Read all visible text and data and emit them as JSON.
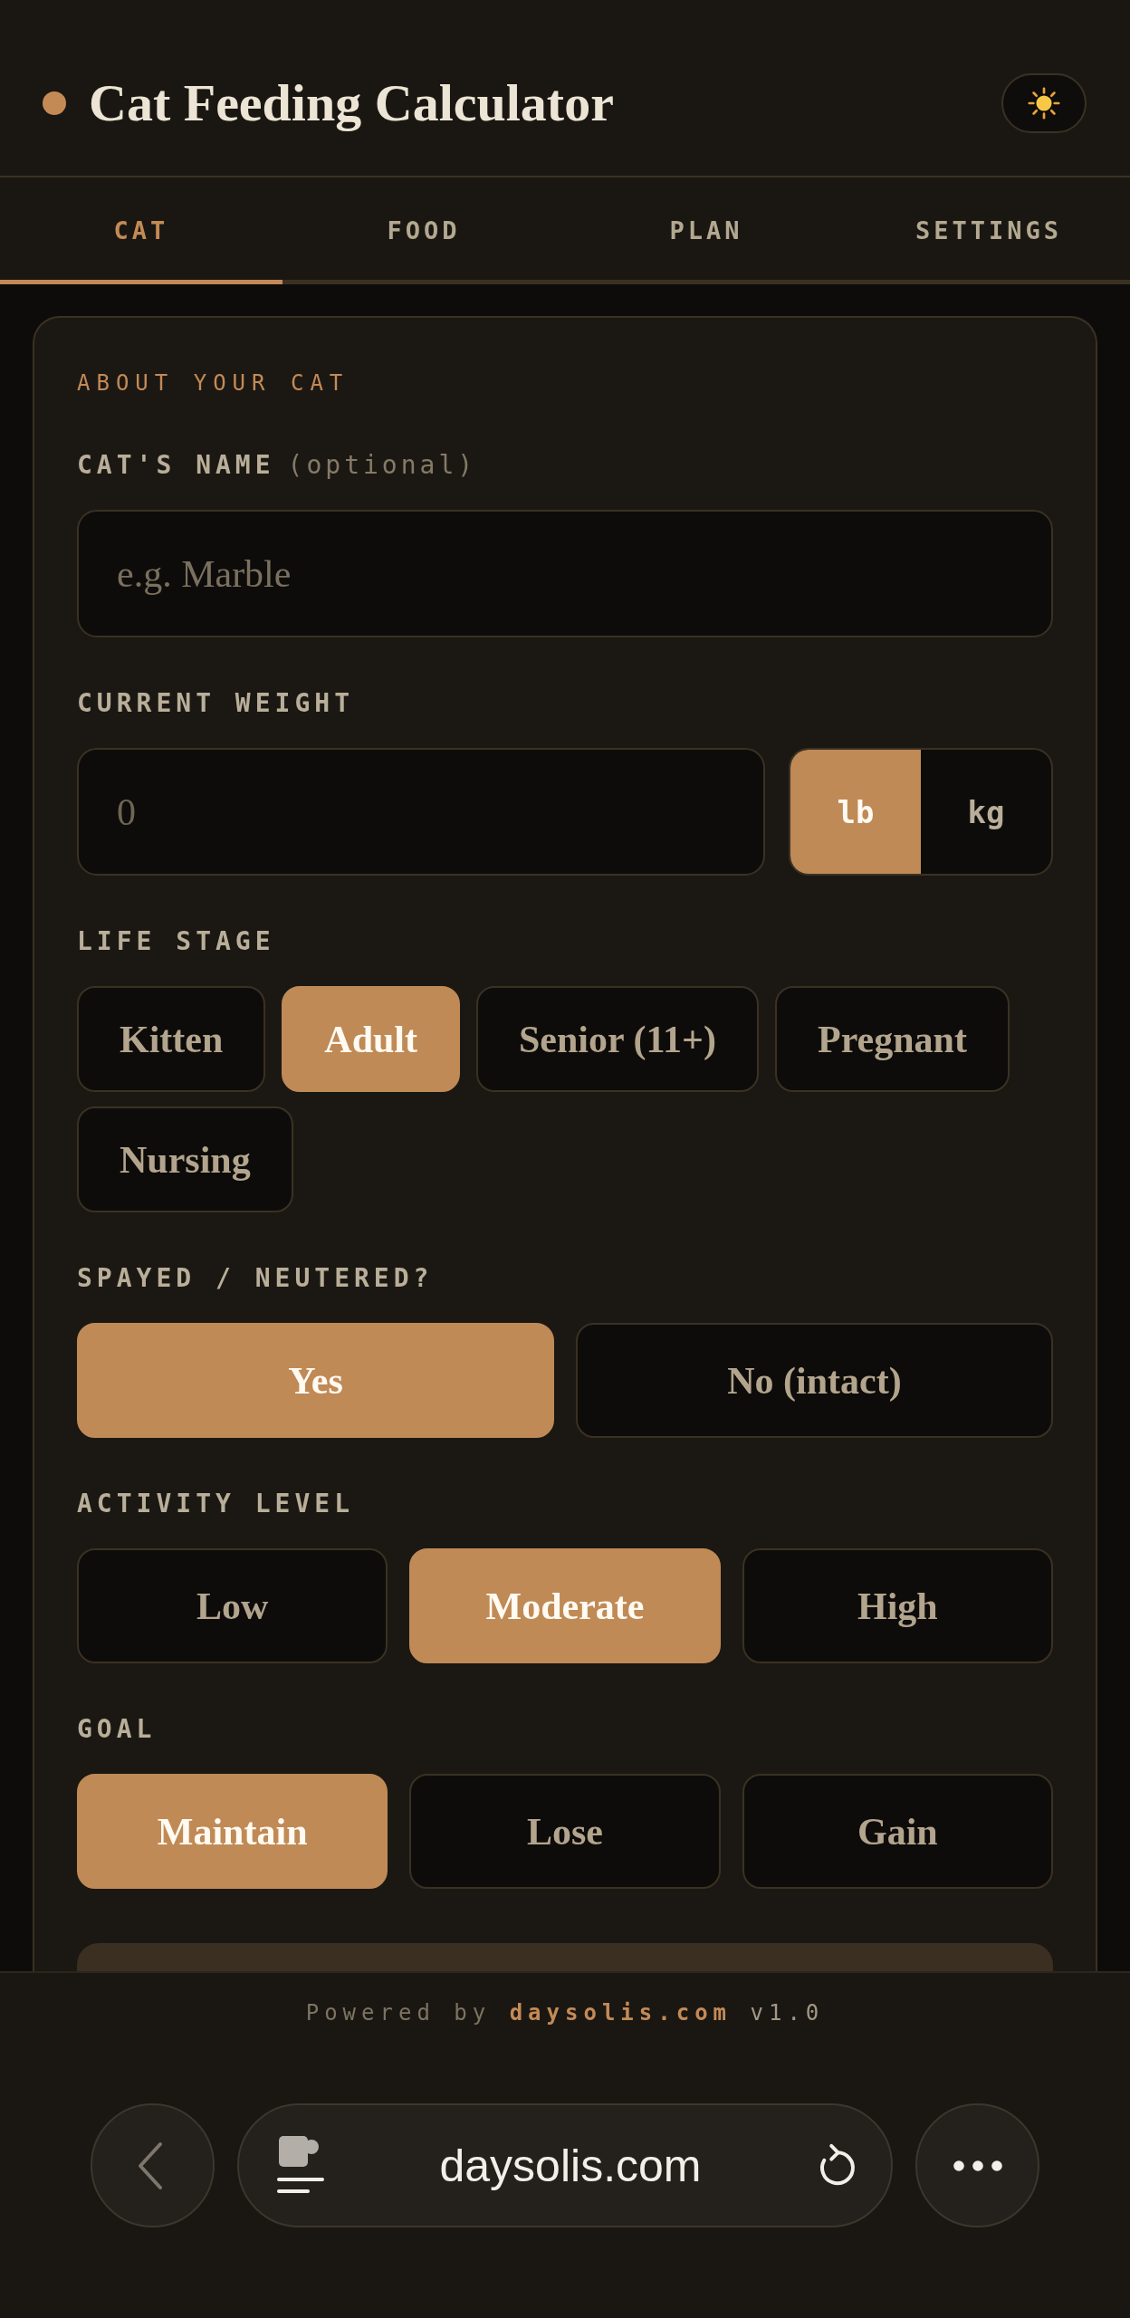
{
  "header": {
    "title": "Cat Feeding Calculator"
  },
  "tabs": [
    {
      "label": "CAT",
      "selected": true
    },
    {
      "label": "FOOD",
      "selected": false
    },
    {
      "label": "PLAN",
      "selected": false
    },
    {
      "label": "SETTINGS",
      "selected": false
    }
  ],
  "card": {
    "heading": "ABOUT YOUR CAT",
    "name_field": {
      "label": "CAT'S NAME",
      "hint": "(optional)",
      "placeholder": "e.g. Marble"
    },
    "weight_field": {
      "label": "CURRENT WEIGHT",
      "placeholder": "0",
      "units": [
        {
          "label": "lb",
          "selected": true
        },
        {
          "label": "kg",
          "selected": false
        }
      ]
    },
    "choice_groups": [
      {
        "label": "LIFE STAGE",
        "kind": "chips",
        "options": [
          {
            "label": "Kitten",
            "selected": false
          },
          {
            "label": "Adult",
            "selected": true
          },
          {
            "label": "Senior (11+)",
            "selected": false
          },
          {
            "label": "Pregnant",
            "selected": false
          },
          {
            "label": "Nursing",
            "selected": false
          }
        ]
      },
      {
        "label": "SPAYED / NEUTERED?",
        "kind": "columns",
        "options": [
          {
            "label": "Yes",
            "selected": true
          },
          {
            "label": "No (intact)",
            "selected": false
          }
        ]
      },
      {
        "label": "ACTIVITY LEVEL",
        "kind": "columns",
        "options": [
          {
            "label": "Low",
            "selected": false
          },
          {
            "label": "Moderate",
            "selected": true
          },
          {
            "label": "High",
            "selected": false
          }
        ]
      },
      {
        "label": "GOAL",
        "kind": "columns",
        "options": [
          {
            "label": "Maintain",
            "selected": true
          },
          {
            "label": "Lose",
            "selected": false
          },
          {
            "label": "Gain",
            "selected": false
          }
        ]
      }
    ]
  },
  "footer": {
    "prefix": "Powered by",
    "link": "daysolis.com",
    "version": "v1.0"
  },
  "browser": {
    "url": "daysolis.com"
  }
}
